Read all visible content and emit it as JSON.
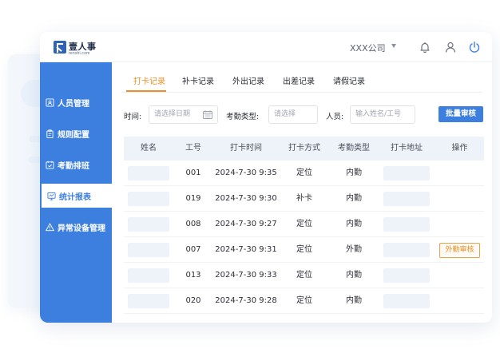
{
  "brand": {
    "name": "壹人事",
    "sub": "renshi.com"
  },
  "topbar": {
    "company": "XXX公司"
  },
  "sidebar": {
    "items": [
      {
        "label": "人员管理",
        "icon": "person-card-icon",
        "active": false
      },
      {
        "label": "规则配置",
        "icon": "clipboard-icon",
        "active": false
      },
      {
        "label": "考勤排班",
        "icon": "calendar-check-icon",
        "active": false
      },
      {
        "label": "统计报表",
        "icon": "chart-screen-icon",
        "active": true
      },
      {
        "label": "异常设备管理",
        "icon": "warning-icon",
        "active": false
      }
    ]
  },
  "tabs": [
    "打卡记录",
    "补卡记录",
    "外出记录",
    "出差记录",
    "请假记录"
  ],
  "active_tab": 0,
  "filters": {
    "time_label": "时间:",
    "time_placeholder": "请选择日期",
    "type_label": "考勤类型:",
    "type_placeholder": "请选择",
    "person_label": "人员:",
    "person_placeholder": "输入姓名/工号",
    "batch_button": "批量审核"
  },
  "table": {
    "headers": [
      "姓名",
      "工号",
      "打卡时间",
      "打卡方式",
      "考勤类型",
      "打卡地址",
      "操作"
    ],
    "rows": [
      {
        "id": "001",
        "time": "2024-7-30 9:35",
        "method": "定位",
        "type": "内勤",
        "action": ""
      },
      {
        "id": "019",
        "time": "2024-7-30 9:30",
        "method": "补卡",
        "type": "内勤",
        "action": ""
      },
      {
        "id": "008",
        "time": "2024-7-30 9:27",
        "method": "定位",
        "type": "内勤",
        "action": ""
      },
      {
        "id": "007",
        "time": "2024-7-30 9:31",
        "method": "定位",
        "type": "外勤",
        "action": "外勤审核"
      },
      {
        "id": "013",
        "time": "2024-7-30 9:33",
        "method": "定位",
        "type": "内勤",
        "action": ""
      },
      {
        "id": "020",
        "time": "2024-7-30 9:28",
        "method": "定位",
        "type": "内勤",
        "action": ""
      }
    ]
  },
  "colors": {
    "primary": "#3d7fde",
    "accent": "#e6912a",
    "header_bg": "#eef3f9"
  }
}
